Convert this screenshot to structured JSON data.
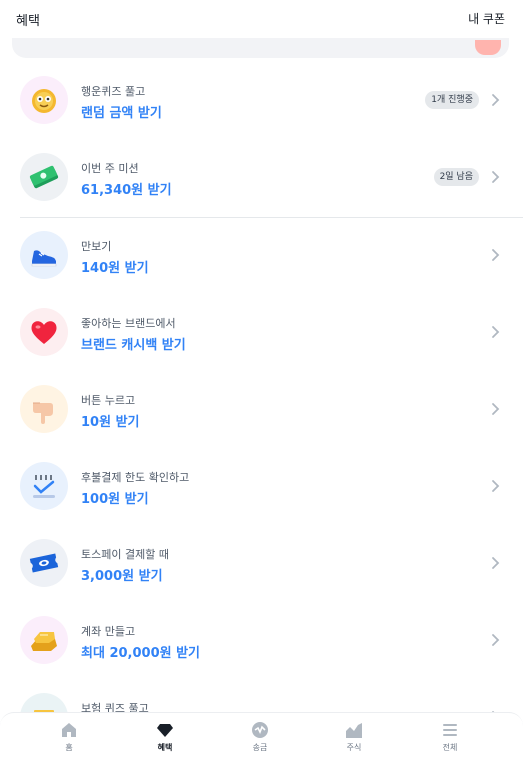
{
  "header": {
    "title": "혜택",
    "coupon_link": "내 쿠폰"
  },
  "items": [
    {
      "icon": "quiz-coin-icon",
      "subtitle": "행운퀴즈 풀고",
      "title": "랜덤 금액 받기",
      "badge": "1개 진행중"
    },
    {
      "icon": "cash-bundle-icon",
      "subtitle": "이번 주 미션",
      "title": "61,340원 받기",
      "badge": "2일 남음"
    },
    {
      "icon": "sneaker-icon",
      "subtitle": "만보기",
      "title": "140원 받기"
    },
    {
      "icon": "heart-icon",
      "subtitle": "좋아하는 브랜드에서",
      "title": "브랜드 캐시백 받기"
    },
    {
      "icon": "pointing-hand-icon",
      "subtitle": "버튼 누르고",
      "title": "10원 받기"
    },
    {
      "icon": "check-card-icon",
      "subtitle": "후불결제 한도 확인하고",
      "title": "100원 받기"
    },
    {
      "icon": "pay-ticket-icon",
      "subtitle": "토스페이 결제할 때",
      "title": "3,000원 받기"
    },
    {
      "icon": "gold-bar-icon",
      "subtitle": "계좌 만들고",
      "title": "최대 20,000원 받기"
    },
    {
      "icon": "insurance-box-icon",
      "subtitle": "보험 퀴즈 풀고",
      "title": ""
    }
  ],
  "tabs": [
    {
      "label": "홈",
      "icon": "home-icon",
      "active": false
    },
    {
      "label": "혜택",
      "icon": "diamond-icon",
      "active": true
    },
    {
      "label": "송금",
      "icon": "transfer-icon",
      "active": false
    },
    {
      "label": "주식",
      "icon": "stock-chart-icon",
      "active": false
    },
    {
      "label": "전체",
      "icon": "menu-icon",
      "active": false
    }
  ],
  "colors": {
    "accent": "#3182f6",
    "text": "#191f28",
    "sub_text": "#4e5968",
    "badge_bg": "#e5e8eb"
  }
}
